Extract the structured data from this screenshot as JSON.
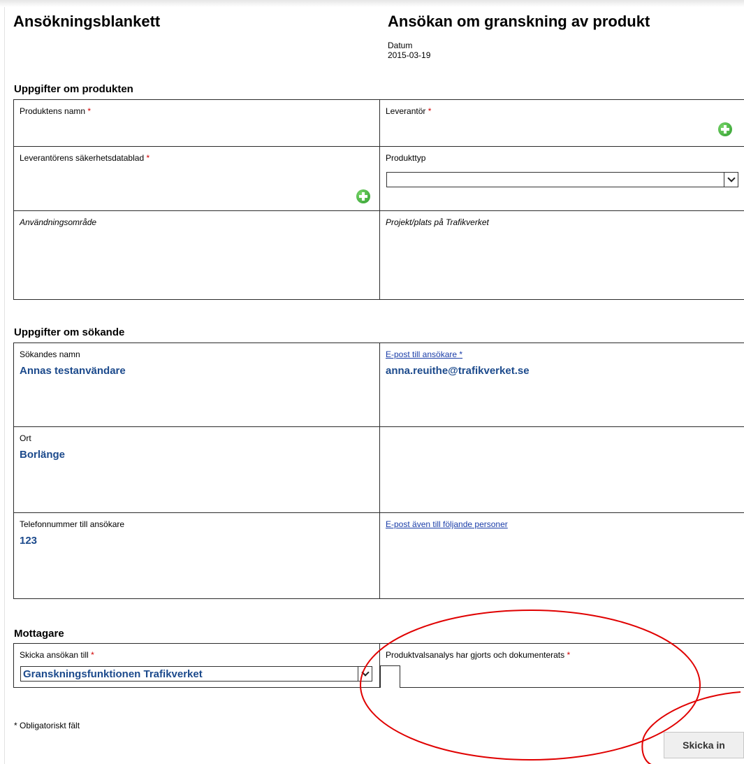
{
  "header": {
    "title_left": "Ansökningsblankett",
    "title_right": "Ansökan om granskning av produkt",
    "date_label": "Datum",
    "date_value": "2015-03-19"
  },
  "product_section": {
    "title": "Uppgifter om produkten",
    "product_name_label": "Produktens namn",
    "supplier_label": "Leverantör",
    "safety_datasheet_label": "Leverantörens säkerhetsdatablad",
    "product_type_label": "Produkttyp",
    "product_type_value": "",
    "usage_area_label": "Användningsområde",
    "project_label": "Projekt/plats på Trafikverket"
  },
  "applicant_section": {
    "title": "Uppgifter om sökande",
    "applicant_name_label": "Sökandes namn",
    "applicant_name_value": "Annas testanvändare",
    "email_label": "E-post till ansökare",
    "email_value": "anna.reuithe@trafikverket.se",
    "city_label": "Ort",
    "city_value": "Borlänge",
    "phone_label": "Telefonnummer till ansökare",
    "phone_value": "123",
    "cc_email_label": "E-post även till följande personer"
  },
  "recipient_section": {
    "title": "Mottagare",
    "send_to_label": "Skicka ansökan till",
    "send_to_value": "Granskningsfunktionen Trafikverket",
    "analysis_label": "Produktvalsanalys har gjorts och dokumenterats"
  },
  "required_mark": "*",
  "footnote": "* Obligatoriskt fält",
  "submit_label": "Skicka in",
  "colors": {
    "required": "#d10000",
    "value_text": "#1c4a8c",
    "link": "#1a3da8",
    "annotation": "#e00000",
    "add_icon": "#2c9a2c"
  }
}
